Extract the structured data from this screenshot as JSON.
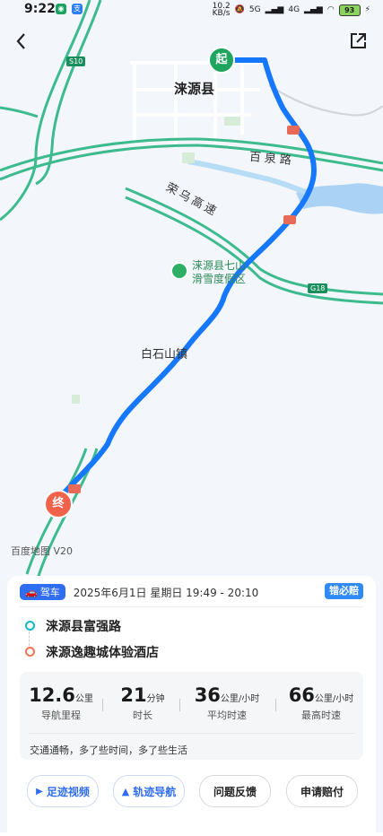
{
  "status_bar": {
    "time": "9:22",
    "network_speed": "10.2 KB/s",
    "net_label_1": "5G",
    "net_label_2": "4G",
    "battery": "93"
  },
  "map": {
    "city": "涞源县",
    "road_1": "百泉路",
    "road_2": "荣乌高速",
    "poi": "涞源县七山滑雪度假区",
    "town": "白石山镇",
    "shield_1": "S10",
    "shield_2": "G18",
    "start_marker": "起",
    "end_marker": "终",
    "watermark": "百度地图 V20",
    "route_color": "#1677ff"
  },
  "trip": {
    "mode_badge": "驾车",
    "date_range": "2025年6月1日 星期日 19:49 - 20:10",
    "insurance_badge": "错必赔",
    "start_location": "涞源县富强路",
    "end_location": "涞源逸趣城体验酒店"
  },
  "stats": [
    {
      "value": "12.6",
      "unit": "公里",
      "label": "导航里程"
    },
    {
      "value": "21",
      "unit": "分钟",
      "label": "时长"
    },
    {
      "value": "36",
      "unit": "公里/小时",
      "label": "平均时速"
    },
    {
      "value": "66",
      "unit": "公里/小时",
      "label": "最高时速"
    }
  ],
  "summary": "交通通畅，多了些时间，多了些生活",
  "actions": {
    "video": "足迹视频",
    "track_nav": "轨迹导航",
    "feedback": "问题反馈",
    "claim": "申请赔付"
  }
}
